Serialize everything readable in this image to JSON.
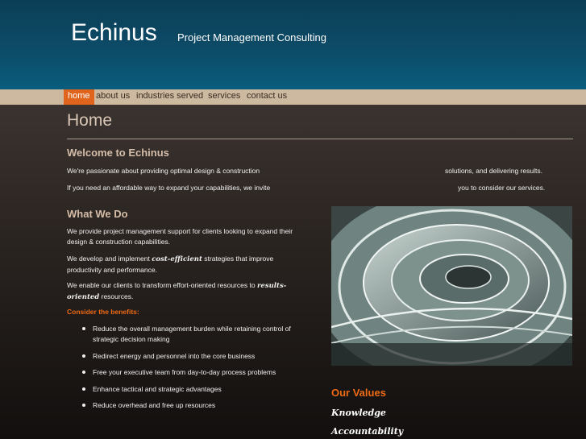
{
  "header": {
    "logo": "Echinus",
    "tagline": "Project Management Consulting"
  },
  "nav": {
    "items": [
      {
        "label": "home",
        "active": true
      },
      {
        "label": "about us",
        "active": false
      },
      {
        "label": "industries served",
        "active": false
      },
      {
        "label": "services",
        "active": false
      },
      {
        "label": "contact us",
        "active": false
      }
    ]
  },
  "page": {
    "title": "Home"
  },
  "welcome": {
    "heading": "Welcome to Echinus",
    "line1_left": "We're passionate about providing optimal design & construction",
    "line1_right": "solutions, and delivering results.",
    "line2_left": "If you need an affordable way to expand your capabilities, we invite",
    "line2_right": "you to consider our services."
  },
  "what_we_do": {
    "heading": "What We Do",
    "p1": "We provide project management support for clients looking to expand their design & construction capabilities.",
    "p2_before": "We develop and implement",
    "p2_em": "cost-efficient",
    "p2_after": "strategies that improve productivity and performance.",
    "p3_before": "We enable our clients to transform effort-oriented resources to",
    "p3_em": "results-oriented",
    "p3_after": "resources.",
    "benefits_heading": "Consider the benefits:",
    "benefits": [
      "Reduce the overall management burden while retaining control of strategic decision making",
      "Redirect energy and personnel into the core business",
      "Free your executive team from day-to-day process problems",
      "Enhance tactical and strategic advantages",
      "Reduce overhead and free up resources"
    ]
  },
  "values": {
    "heading": "Our Values",
    "items": [
      "Knowledge",
      "Accountability"
    ]
  },
  "colors": {
    "accent": "#ee6a14",
    "header": "#0d4a66",
    "nav": "#cdb8a0"
  }
}
